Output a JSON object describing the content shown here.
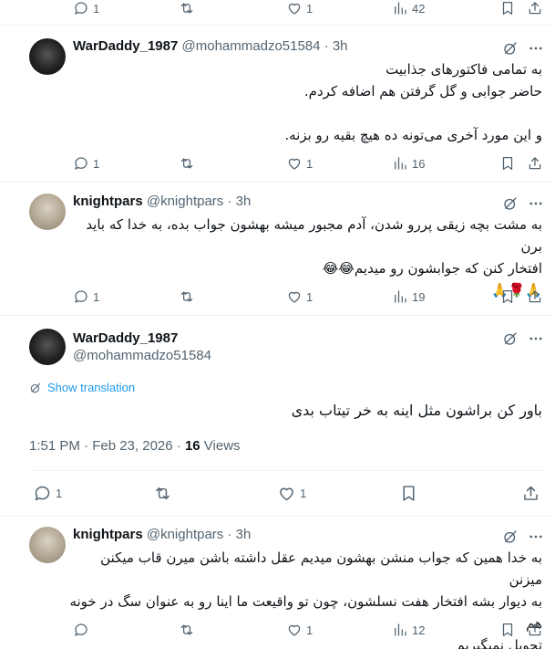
{
  "top_actions": {
    "replies": "1",
    "reposts": "",
    "likes": "1",
    "views": "42"
  },
  "tweets": [
    {
      "name": "WarDaddy_1987",
      "handle": "@mohammadzo51584 · 3h",
      "lines": [
        "به تمامی فاکتورهای جذابیت",
        "حاضر جوابی و گل گرفتن هم اضافه کردم.",
        "",
        "و این مورد آخری می‌تونه ده هیچ بقیه رو بزنه."
      ],
      "replies": "1",
      "likes": "1",
      "views": "16"
    },
    {
      "name": "knightpars",
      "handle": "@knightpars · 3h",
      "lines": [
        "به مشت بچه زیقی پررو شدن، آدم مجبور میشه بهشون جواب بده، به خدا که باید برن",
        "افتخار کنن که جوابشون رو میدیم😂😂",
        "🙏🌹🙏"
      ],
      "replies": "1",
      "likes": "1",
      "views": "19"
    }
  ],
  "main_tweet": {
    "name": "WarDaddy_1987",
    "handle": "@mohammadzo51584",
    "show_translation": "Show translation",
    "text": "باور کن براشون مثل اینه به خر تیتاب بدی",
    "time": "1:51 PM · Feb 23, 2026 · ",
    "views_count": "16",
    "views_label": " Views",
    "replies": "1",
    "likes": "1"
  },
  "last_tweet": {
    "name": "knightpars",
    "handle": "@knightpars · 3h",
    "lines": [
      "به خدا همین که جواب منشن بهشون میدیم عقل داشته باشن میرن قاب میکنن میزنن",
      "به دیوار بشه افتخار هفت نسلشون، چون تو واقیعت ما اینا رو به عنوان سگ در خونه هم",
      "تحویل نمیگیریم"
    ],
    "likes": "1",
    "views": "12"
  },
  "icons": [
    "reply-icon",
    "repost-icon",
    "like-icon",
    "views-icon",
    "bookmark-icon",
    "share-icon",
    "grok-icon",
    "more-icon",
    "translate-icon"
  ],
  "colors": {
    "text": "#0f1419",
    "secondary": "#536471",
    "link": "#1d9bf0",
    "divider": "#eff3f4"
  }
}
